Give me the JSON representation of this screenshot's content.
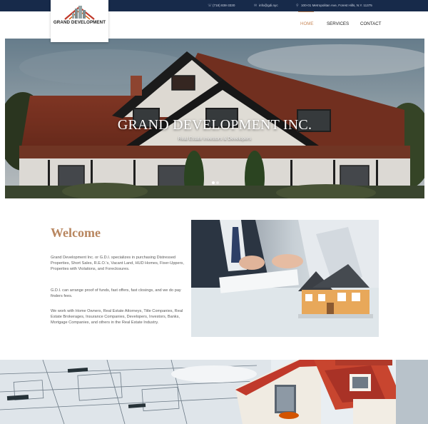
{
  "topbar": {
    "phone": "(718) 838-3330",
    "email": "info@gdi.nyc",
    "address": "100-01 Metropolitan Ave, Forest Hills, N.Y. 11375",
    "phone_icon": "phone-icon",
    "email_icon": "envelope-icon",
    "address_icon": "map-pin-icon"
  },
  "logo": {
    "text": "GRAND DEVELOPMENT"
  },
  "nav": {
    "home": "HOME",
    "services": "SERVICES",
    "contact": "CONTACT"
  },
  "hero": {
    "title": "GRAND DEVELOPMENT INC.",
    "subtitle": "Real Estate Investors & Developers",
    "slides": 2,
    "active_slide": 1
  },
  "welcome": {
    "title": "Welcome",
    "paragraphs": [
      "Grand Development Inc. or G.D.I. specializes in purchasing Distressed Properties, Short Sales, R.E.O.'s, Vacant Land, HUD Homes, Fixer-Uppers, Properties with Violations, and Foreclosures.",
      "G.D.I. can arrange proof of funds, fast offers, fast closings, and we do pay finders fees.",
      "We work with Home Owners, Real Estate Attorneys, Title Companies, Real Estate Brokerages, Insurance Companies, Developers, Investors, Banks, Mortgage Companies, and others in the Real Estate Industry."
    ]
  },
  "colors": {
    "topbar": "#172a4a",
    "accent": "#c98a5b",
    "welcome_title": "#b8865f"
  }
}
